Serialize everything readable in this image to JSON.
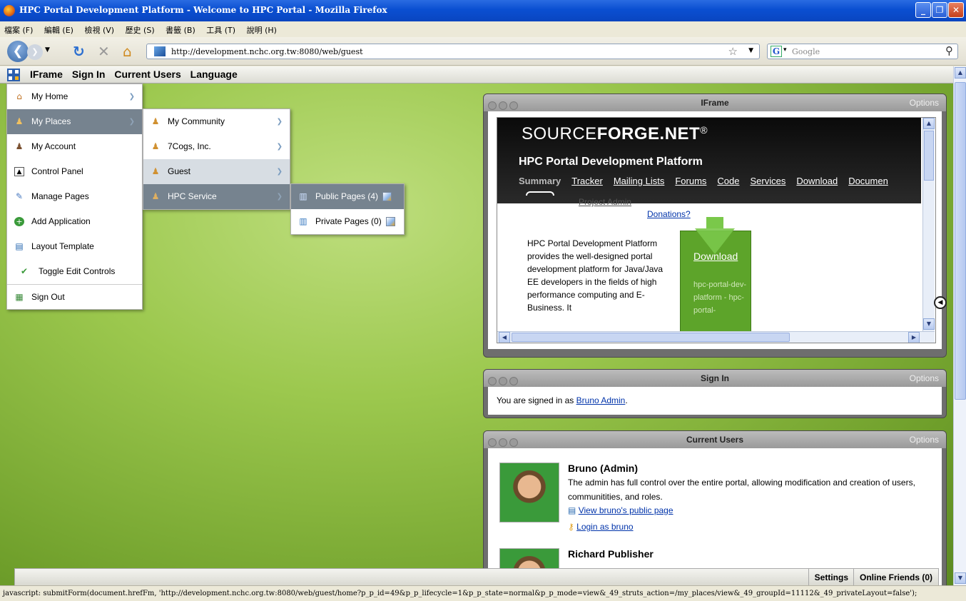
{
  "window": {
    "title": "HPC Portal Development Platform - Welcome to HPC Portal - Mozilla Firefox"
  },
  "menubar": [
    "檔案 (F)",
    "編輯 (E)",
    "檢視 (V)",
    "歷史 (S)",
    "書籤 (B)",
    "工具 (T)",
    "說明 (H)"
  ],
  "nav": {
    "url": "http://development.nchc.org.tw:8080/web/guest",
    "search_placeholder": "Google"
  },
  "dockbar": {
    "items": [
      "IFrame",
      "Sign In",
      "Current Users",
      "Language"
    ]
  },
  "menu": {
    "items": [
      {
        "label": "My Home",
        "icon": "home-icon"
      },
      {
        "label": "My Places",
        "icon": "users-icon"
      },
      {
        "label": "My Account",
        "icon": "user-icon"
      },
      {
        "label": "Control Panel",
        "icon": "panel-icon"
      },
      {
        "label": "Manage Pages",
        "icon": "pages-icon"
      },
      {
        "label": "Add Application",
        "icon": "add-icon"
      },
      {
        "label": "Layout Template",
        "icon": "layout-icon"
      },
      {
        "label": "Toggle Edit Controls",
        "icon": "check-icon"
      },
      {
        "label": "Sign Out",
        "icon": "signout-icon"
      }
    ],
    "places": [
      "My Community",
      "7Cogs, Inc.",
      "Guest",
      "HPC Service"
    ],
    "pages": [
      "Public Pages (4)",
      "Private Pages (0)"
    ]
  },
  "iframe_portlet": {
    "title": "IFrame",
    "options": "Options",
    "brand_light": "SOURCE",
    "brand_bold": "FORGE.NET",
    "brand_reg": "®",
    "project_title": "HPC Portal Development Platform",
    "tabs": [
      "Summary",
      "Tracker",
      "Mailing Lists",
      "Forums",
      "Code",
      "Services",
      "Download",
      "Documen"
    ],
    "project_admin": "Project Admin",
    "donations": "Donations?",
    "description": "HPC Portal Development Platform provides the well-designed portal development platform for Java/Java EE developers in the fields of high performance computing and E-Business. It",
    "download_label": "Download",
    "download_file": "hpc-portal-dev-platform - hpc-portal-"
  },
  "signin_portlet": {
    "title": "Sign In",
    "options": "Options",
    "text_prefix": "You are signed in as ",
    "user_link": "Bruno Admin",
    "text_suffix": "."
  },
  "users_portlet": {
    "title": "Current Users",
    "options": "Options",
    "users": [
      {
        "name": "Bruno (Admin)",
        "description": "The admin has full control over the entire portal, allowing modification and creation of users, communitities, and roles.",
        "view_link": "View bruno's public page",
        "login_link": "Login as bruno"
      },
      {
        "name": "Richard Publisher"
      }
    ]
  },
  "bottombar": {
    "settings": "Settings",
    "online_friends": "Online Friends (0)"
  },
  "statusbar": "javascript: submitForm(document.hrefFm, 'http://development.nchc.org.tw:8080/web/guest/home?p_p_id=49&p_p_lifecycle=1&p_p_state=normal&p_p_mode=view&_49_struts_action=/my_places/view&_49_groupId=11112&_49_privateLayout=false');"
}
